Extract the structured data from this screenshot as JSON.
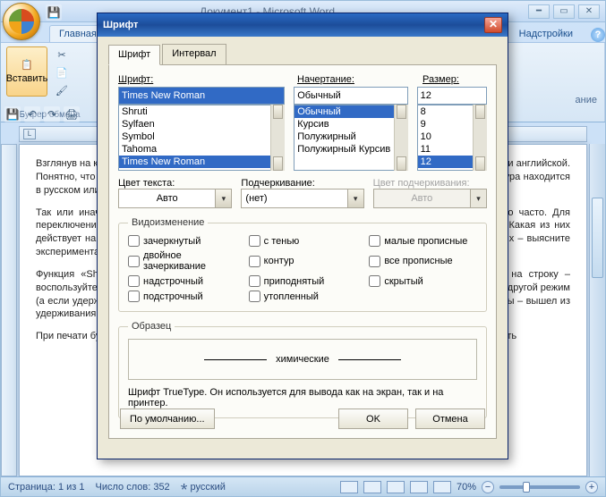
{
  "window": {
    "title": "Документ1 - Microsoft Word"
  },
  "ribbon": {
    "tabs": {
      "home": "Главная",
      "addins": "Надстройки"
    },
    "clipboard_group": "Буфер обмена",
    "font_group_trail": "ание",
    "paste": "Вставить"
  },
  "document": {
    "p1": "Взглянув на клавиатуру, вы обнаружите, что каждая кнопка-буква подписана двумя буквами – русской и английской. Понятно, что одновременно печатать на двух языках нельзя, что в какой-то момент времени клавиатура находится в русском или английском режиме. А вот как это контролировать, -",
    "p2": "Так или иначе, переключение с русского на английский и обратно приходится делать достаточно часто. Для переключения языка применяют клавиатурную комбинацию «Alt слева + Shift» либо «Caps Lock». Какая из них действует на вашем компьютере – зависит от настроек (или заглавных букв Caps Lock). Какая из них – выясните экспериментально (или неудобно во что-то часто, переключение).",
    "p3": "Функция «Shift» действует на одну букву. А если с неё начать печатать много больших букв на строку – воспользуйтесь клавишей фиксации «Caps Lock». При нажатии на эту кнопку клавиатура переходит в другой режим (а если удерживать – обратный эффект). Теперь, чтобы напечатать удобно – строчные буквы, секунды – вышел из удерживания клавиатуры.",
    "p4": "При печати буквы будут печататься большие и наоборот. Просто попробуйте для тренировки напечатать"
  },
  "status": {
    "page": "Страница: 1 из 1",
    "words": "Число слов: 352",
    "lang": "русский",
    "zoom": "70%"
  },
  "dialog": {
    "title": "Шрифт",
    "tabs": {
      "font": "Шрифт",
      "interval": "Интервал"
    },
    "labels": {
      "font": "Шрифт:",
      "style": "Начертание:",
      "size": "Размер:",
      "color": "Цвет текста:",
      "underline": "Подчеркивание:",
      "underline_color": "Цвет подчеркивания:"
    },
    "font_input": "Times New Roman",
    "font_list": [
      "Shruti",
      "Sylfaen",
      "Symbol",
      "Tahoma",
      "Times New Roman"
    ],
    "font_selected": "Times New Roman",
    "style_input": "Обычный",
    "style_list": [
      "Обычный",
      "Курсив",
      "Полужирный",
      "Полужирный Курсив"
    ],
    "style_selected": "Обычный",
    "size_input": "12",
    "size_list": [
      "8",
      "9",
      "10",
      "11",
      "12"
    ],
    "size_selected": "12",
    "color_value": "Авто",
    "underline_value": "(нет)",
    "underline_color_value": "Авто",
    "effects_legend": "Видоизменение",
    "effects": {
      "strikethrough": "зачеркнутый",
      "double_strike": "двойное зачеркивание",
      "superscript": "надстрочный",
      "subscript": "подстрочный",
      "shadow": "с тенью",
      "outline": "контур",
      "emboss": "приподнятый",
      "engrave": "утопленный",
      "smallcaps": "малые прописные",
      "allcaps": "все прописные",
      "hidden": "скрытый"
    },
    "sample_legend": "Образец",
    "sample_text": "химические",
    "info": "Шрифт TrueType. Он используется для вывода как на экран, так и на принтер.",
    "buttons": {
      "default": "По умолчанию...",
      "ok": "OK",
      "cancel": "Отмена"
    }
  }
}
